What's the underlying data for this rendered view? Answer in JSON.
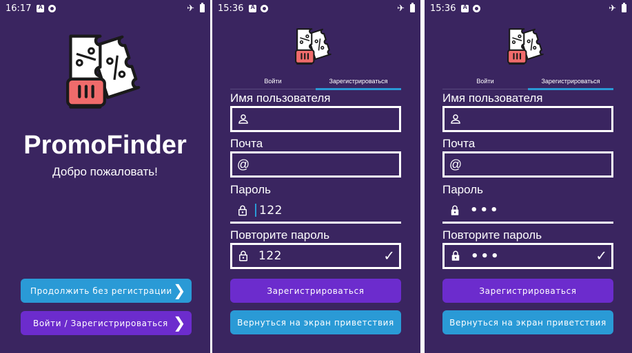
{
  "screen1": {
    "status": {
      "time": "16:17"
    },
    "app_name": "PromoFinder",
    "welcome": "Добро пожаловать!",
    "btn_guest": "Продолжить без регистрации",
    "btn_login": "Войти / Зарегистрироваться"
  },
  "screen2": {
    "status": {
      "time": "15:36"
    },
    "tabs": [
      "Войти",
      "Зарегистрироваться"
    ],
    "active_tab": 1,
    "fields": {
      "username_label": "Имя пользователя",
      "username_value": "",
      "email_label": "Почта",
      "email_value": "",
      "password_label": "Пароль",
      "password_value": "122",
      "repeat_label": "Повторите пароль",
      "repeat_value": "122"
    },
    "btn_register": "Зарегистрироваться",
    "btn_back": "Вернуться на экран приветствия"
  },
  "screen3": {
    "status": {
      "time": "15:36"
    },
    "tabs": [
      "Войти",
      "Зарегистрироваться"
    ],
    "active_tab": 1,
    "fields": {
      "username_label": "Имя пользователя",
      "username_value": "",
      "email_label": "Почта",
      "email_value": "",
      "password_label": "Пароль",
      "password_value": "•••",
      "repeat_label": "Повторите пароль",
      "repeat_value": "•••"
    },
    "btn_register": "Зарегистрироваться",
    "btn_back": "Вернуться на экран приветствия"
  },
  "colors": {
    "background": "#3a2560",
    "accent_blue": "#2a9ad6",
    "accent_purple": "#6c2ccd",
    "logo_red": "#f06b6b"
  },
  "icons": [
    "user-icon",
    "at-icon",
    "lock-icon",
    "check-icon",
    "chevron-right-icon",
    "airplane-icon",
    "battery-icon",
    "ticket-logo"
  ]
}
